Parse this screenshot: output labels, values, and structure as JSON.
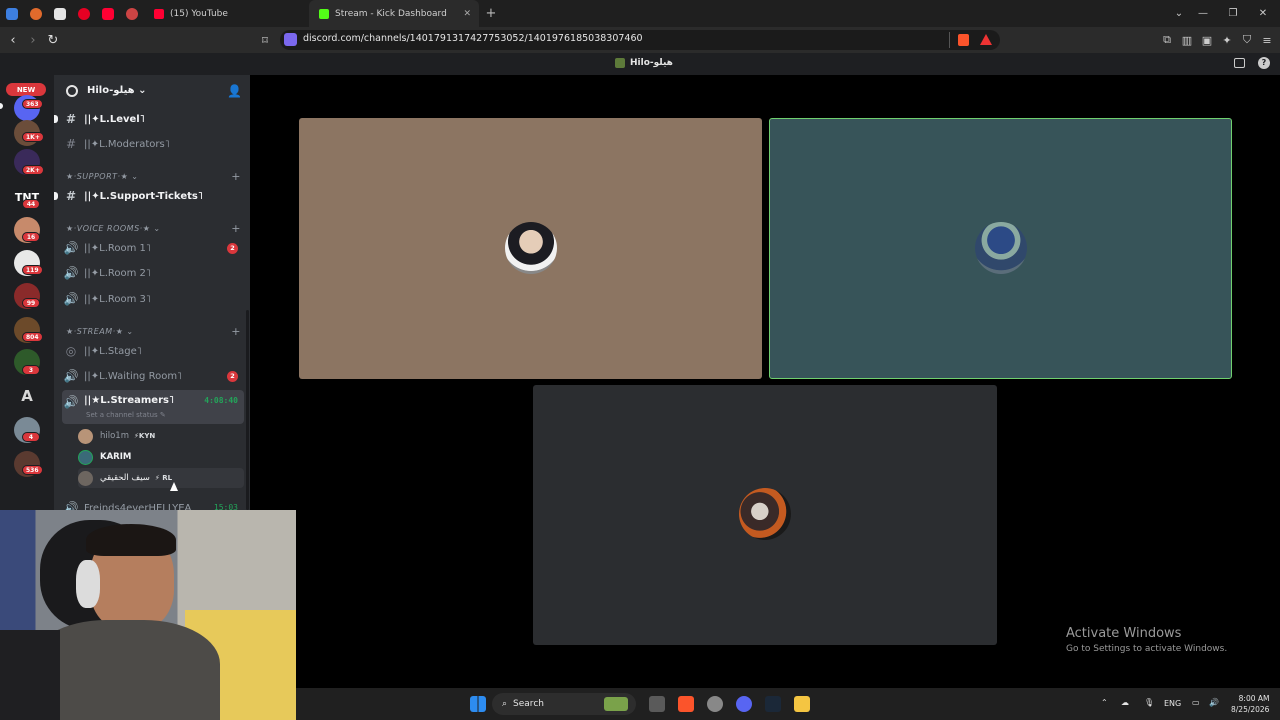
{
  "browser": {
    "tabs": [
      {
        "title": "(15) YouTube"
      },
      {
        "title": "Stream - Kick Dashboard"
      }
    ],
    "new_tab": "+",
    "url": "discord.com/channels/1401791317427753052/1401976185038307460"
  },
  "discord": {
    "window_title": "Hilo-هيلو",
    "server_rail": {
      "new_label": "NEW",
      "badges": [
        "363",
        "1K+",
        "2K+",
        "44",
        "16",
        "119",
        "99",
        "804",
        "3",
        "4",
        "536"
      ],
      "server_labels": [
        "TNT",
        "A"
      ]
    },
    "server_name": "Hilo-هيلو",
    "channels": [
      {
        "name": "||✦L.Level˥",
        "icon": "hash-icon"
      },
      {
        "name": "||✦L.Moderators˥",
        "icon": "hash-icon"
      }
    ],
    "categories": {
      "support": "★·SUPPORT·★",
      "voice": "★·VOICE ROOMS·★",
      "stream": "★·STREAM·★"
    },
    "support_channel": "||✦L.Support-Tickets˥",
    "voice_rooms": [
      {
        "name": "||✦L.Room 1˥",
        "badge": "2"
      },
      {
        "name": "||✦L.Room 2˥"
      },
      {
        "name": "||✦L.Room 3˥"
      }
    ],
    "stream_channels": {
      "stage": "||✦L.Stage˥",
      "waiting": "||✦L.Waiting Room˥",
      "waiting_badge": "2",
      "streamers": "||★L.Streamers˥",
      "streamers_timer": "4:08:40",
      "status_hint": "Set a channel status",
      "partial_channel": "Freinds4everHELLYEA",
      "partial_timer": "15:03"
    },
    "voice_users": [
      {
        "name": "hilo1m",
        "tag": "⚡KYN"
      },
      {
        "name": "KARIM",
        "tag": ""
      },
      {
        "name": "سيف الحقيقي",
        "tag": "⚡ RL"
      }
    ]
  },
  "windows_notice": {
    "title": "Activate Windows",
    "subtitle": "Go to Settings to activate Windows."
  },
  "taskbar": {
    "search": "Search",
    "lang": "ENG",
    "time": "8:00 AM",
    "date": "8/25/2026"
  },
  "colors": {
    "tile_1": "#8c7562",
    "tile_2": "#375459",
    "tile_3": "#2b2d30",
    "speaking_border": "#6fd06f",
    "badge_red": "#da373c",
    "online_green": "#23a55a"
  }
}
